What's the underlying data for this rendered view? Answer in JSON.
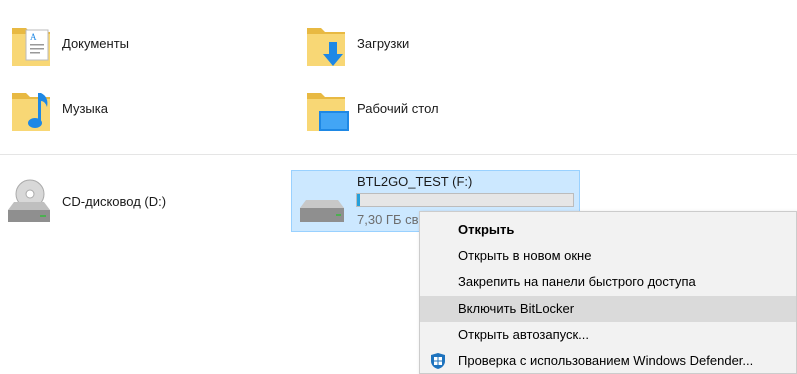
{
  "folders": [
    {
      "label": "Документы",
      "icon": "documents-folder-icon"
    },
    {
      "label": "Загрузки",
      "icon": "downloads-folder-icon"
    },
    {
      "label": "Музыка",
      "icon": "music-folder-icon"
    },
    {
      "label": "Рабочий стол",
      "icon": "desktop-folder-icon"
    }
  ],
  "drives": [
    {
      "label": "CD-дисковод (D:)",
      "icon": "cd-drive-icon"
    },
    {
      "label": "BTL2GO_TEST (F:)",
      "icon": "usb-drive-icon",
      "free_text": "7,30 ГБ св",
      "used_fraction": 0.015
    }
  ],
  "context_menu": {
    "items": [
      {
        "label": "Открыть",
        "bold": true
      },
      {
        "label": "Открыть в новом окне"
      },
      {
        "label": "Закрепить на панели быстрого доступа"
      },
      {
        "label": "Включить BitLocker",
        "highlighted": true
      },
      {
        "label": "Открыть автозапуск..."
      },
      {
        "label": "Проверка с использованием Windows Defender...",
        "icon": "windows-defender-shield-icon"
      }
    ]
  },
  "colors": {
    "selection_bg": "#cce8ff",
    "selection_border": "#99d1ff",
    "progress_fill": "#26a0da",
    "folder_yellow": "#f8d775",
    "accent_blue": "#1e88e5"
  }
}
